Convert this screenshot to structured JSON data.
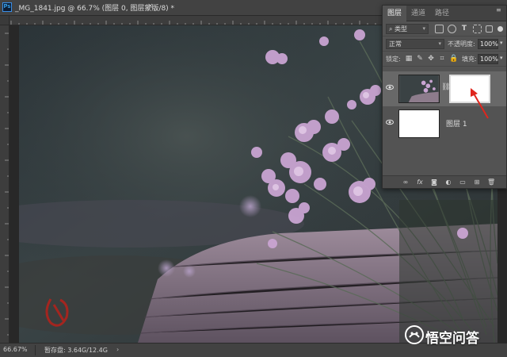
{
  "document": {
    "title": "_MG_1841.jpg @ 66.7% (图层 0, 图层蒙版/8) *",
    "badge": "Ps",
    "close": "×"
  },
  "layers_panel": {
    "tabs": [
      {
        "label": "图层",
        "active": true
      },
      {
        "label": "通道",
        "active": false
      },
      {
        "label": "路径",
        "active": false
      }
    ],
    "filter": {
      "selected": "类型"
    },
    "blend_mode": {
      "selected": "正常"
    },
    "opacity": {
      "label": "不透明度:",
      "value": "100%"
    },
    "lock": {
      "label": "锁定:"
    },
    "fill": {
      "label": "填充:",
      "value": "100%"
    },
    "layers": [
      {
        "name": "",
        "has_mask": true,
        "visible": true,
        "selected": true
      },
      {
        "name": "图层 1",
        "has_mask": false,
        "visible": true,
        "selected": false
      }
    ],
    "footer_icons": [
      "link-icon",
      "fx-icon",
      "mask-icon",
      "adjustment-icon",
      "folder-icon",
      "new-layer-icon",
      "trash-icon"
    ]
  },
  "status_bar": {
    "zoom": "66.67%",
    "scratch": "暂存盘: 3.64G/12.4G",
    "arrow": "›"
  },
  "watermark": {
    "text": "悟空问答"
  },
  "colors": {
    "accent_red": "#e0261d",
    "panel_bg": "#535353",
    "selected_layer": "#686868"
  }
}
